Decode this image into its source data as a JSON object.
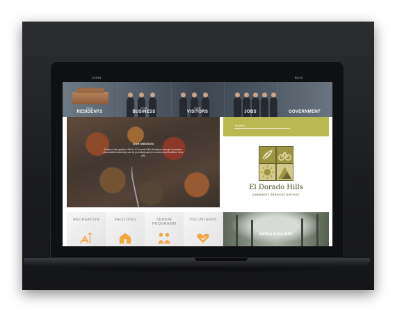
{
  "topbar": {
    "left_link": "LOGIN",
    "right_link": "BLOG"
  },
  "hero": {
    "segments": [
      {
        "small": "FOR",
        "label": "RESIDENTS"
      },
      {
        "small": "FOR",
        "label": "BUSINESS"
      },
      {
        "small": "FOR",
        "label": "VISITORS"
      },
      {
        "small": "",
        "label": "JOBS"
      },
      {
        "small": "",
        "label": "GOVERNMENT"
      }
    ]
  },
  "mission": {
    "title": "OUR MISSION",
    "text": "Enhance the quality of life for El Dorado Hills Residents through innovative, responsible leadership and by providing superior services and facilities. More info"
  },
  "search": {
    "placeholder": "SEARCH"
  },
  "logo": {
    "name": "El Dorado Hills",
    "subtitle": "COMMUNITY SERVICES DISTRICT",
    "colors": {
      "dark": "#9c9541",
      "light": "#d1ca8a",
      "band": "#b8b952"
    }
  },
  "tiles": [
    {
      "label": "RECREATION",
      "icon": "beach-chair-icon"
    },
    {
      "label": "FACILITIES",
      "icon": "building-icon"
    },
    {
      "label": "SENIOR\nPROGRAMM",
      "icon": "people-icon"
    },
    {
      "label": "VOLUNTEERS",
      "icon": "heart-hand-icon"
    }
  ],
  "media": {
    "label": "MEDIA GALLERY"
  },
  "accent": "#f2a541"
}
